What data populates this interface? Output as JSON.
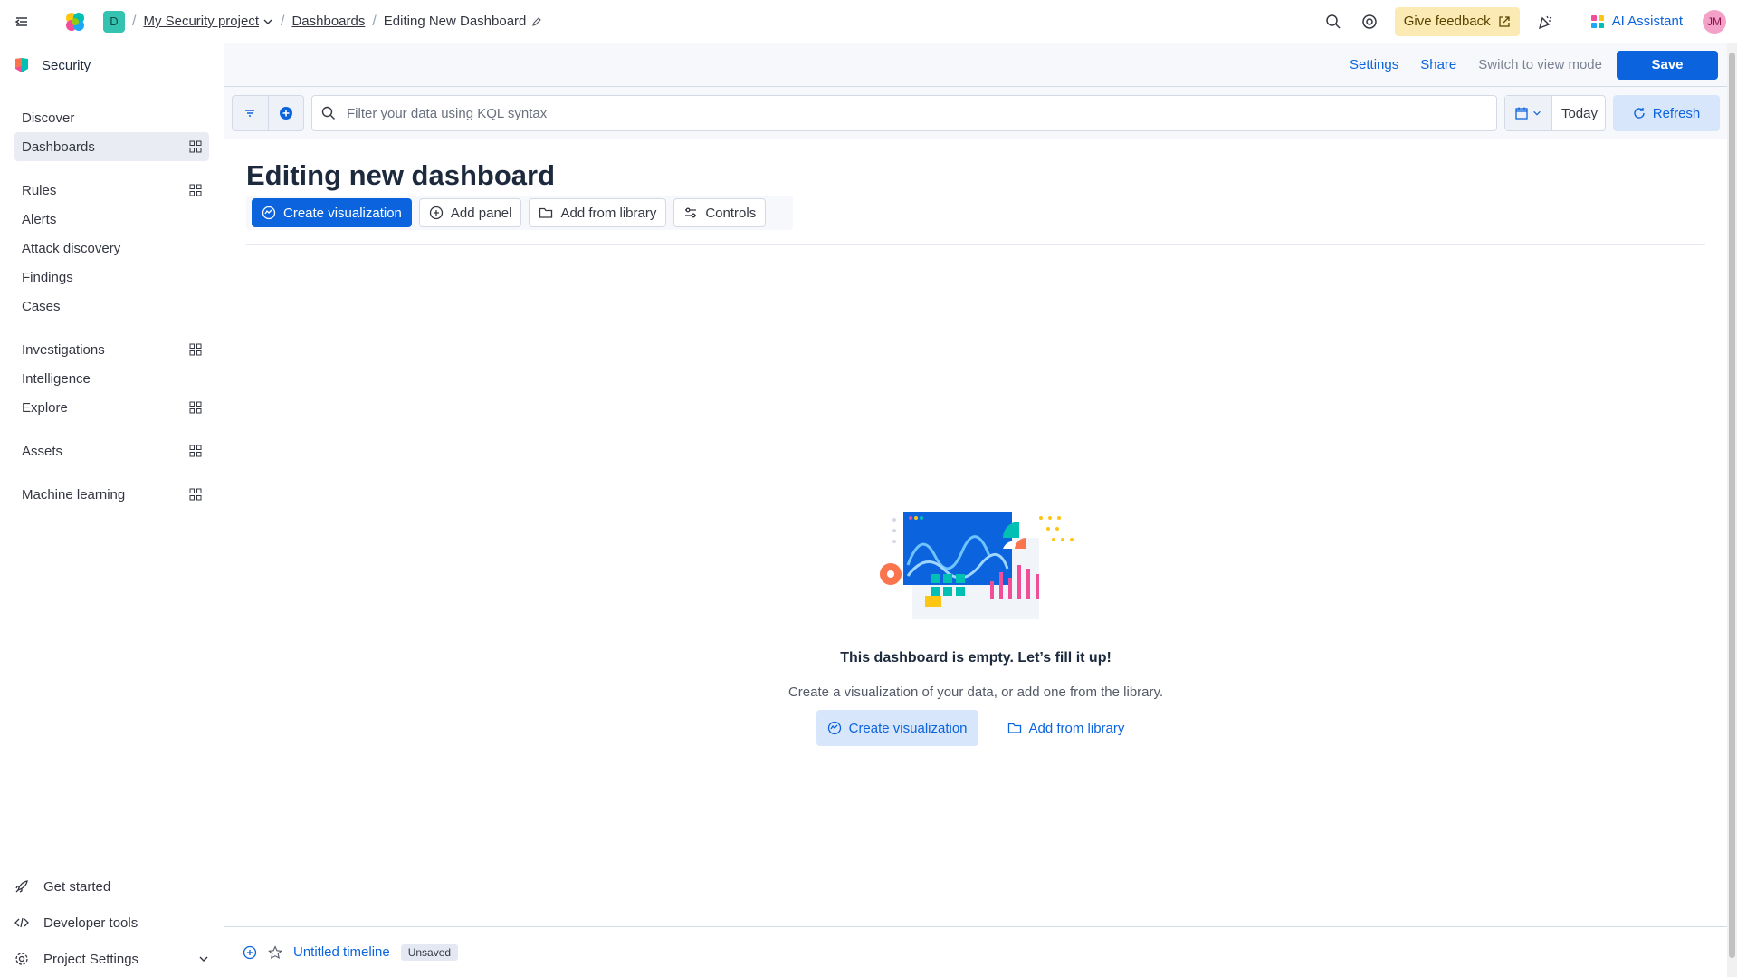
{
  "header": {
    "project": "My Security project",
    "space_initial": "D",
    "breadcrumbs": [
      "Dashboards",
      "Editing New Dashboard"
    ],
    "feedback_label": "Give feedback",
    "ai_label": "AI Assistant",
    "avatar_initials": "JM"
  },
  "sidebar": {
    "app_title": "Security",
    "items": [
      {
        "label": "Discover"
      },
      {
        "label": "Dashboards"
      },
      {
        "label": "Rules"
      },
      {
        "label": "Alerts"
      },
      {
        "label": "Attack discovery"
      },
      {
        "label": "Findings"
      },
      {
        "label": "Cases"
      },
      {
        "label": "Investigations"
      },
      {
        "label": "Intelligence"
      },
      {
        "label": "Explore"
      },
      {
        "label": "Assets"
      },
      {
        "label": "Machine learning"
      }
    ],
    "bottom": [
      {
        "label": "Get started"
      },
      {
        "label": "Developer tools"
      },
      {
        "label": "Project Settings"
      }
    ]
  },
  "topnav": {
    "settings": "Settings",
    "share": "Share",
    "view_mode": "Switch to view mode",
    "save": "Save"
  },
  "query": {
    "placeholder": "Filter your data using KQL syntax",
    "date": "Today",
    "refresh": "Refresh"
  },
  "dashboard": {
    "title": "Editing new dashboard",
    "toolbar": {
      "create": "Create visualization",
      "add_panel": "Add panel",
      "add_library": "Add from library",
      "controls": "Controls"
    },
    "empty": {
      "title": "This dashboard is empty. Let’s fill it up!",
      "description": "Create a visualization of your data, or add one from the library.",
      "create": "Create visualization",
      "add_library": "Add from library"
    }
  },
  "timeline": {
    "title": "Untitled timeline",
    "badge": "Unsaved"
  },
  "colors": {
    "primary": "#0b64dd",
    "feedback_bg": "#fceab4"
  }
}
